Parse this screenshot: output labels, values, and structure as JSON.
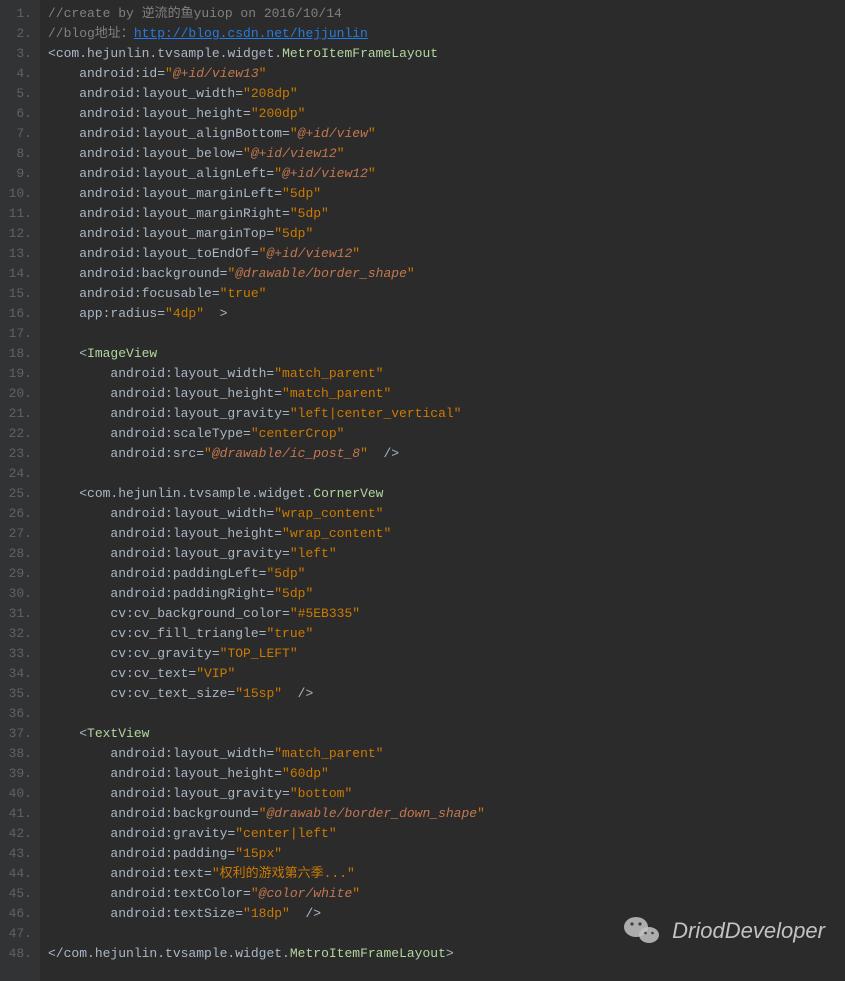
{
  "watermark": {
    "text": "DriodDeveloper"
  },
  "code_render": {
    "1": [
      {
        "cls": "c-comment",
        "t": "//create by 逆流的鱼yuiop on 2016/10/14"
      }
    ],
    "2": [
      {
        "cls": "c-comment",
        "t": "//blog地址："
      },
      {
        "cls": "c-url",
        "t": "http://blog.csdn.net/hejjunlin"
      }
    ],
    "3": [
      {
        "cls": "c-bracket",
        "t": "<"
      },
      {
        "cls": "c-default",
        "t": "com.hejunlin.tvsample.widget."
      },
      {
        "cls": "c-class",
        "t": "MetroItemFrameLayout"
      }
    ],
    "4": [
      {
        "cls": "c-default",
        "t": "    android:id="
      },
      {
        "cls": "c-str",
        "t": "\""
      },
      {
        "cls": "c-id",
        "t": "@+id/view13"
      },
      {
        "cls": "c-str",
        "t": "\""
      }
    ],
    "5": [
      {
        "cls": "c-default",
        "t": "    android:layout_width="
      },
      {
        "cls": "c-str",
        "t": "\"208dp\""
      }
    ],
    "6": [
      {
        "cls": "c-default",
        "t": "    android:layout_height="
      },
      {
        "cls": "c-str",
        "t": "\"200dp\""
      }
    ],
    "7": [
      {
        "cls": "c-default",
        "t": "    android:layout_alignBottom="
      },
      {
        "cls": "c-str",
        "t": "\""
      },
      {
        "cls": "c-id",
        "t": "@+id/view"
      },
      {
        "cls": "c-str",
        "t": "\""
      }
    ],
    "8": [
      {
        "cls": "c-default",
        "t": "    android:layout_below="
      },
      {
        "cls": "c-str",
        "t": "\""
      },
      {
        "cls": "c-id",
        "t": "@+id/view12"
      },
      {
        "cls": "c-str",
        "t": "\""
      }
    ],
    "9": [
      {
        "cls": "c-default",
        "t": "    android:layout_alignLeft="
      },
      {
        "cls": "c-str",
        "t": "\""
      },
      {
        "cls": "c-id",
        "t": "@+id/view12"
      },
      {
        "cls": "c-str",
        "t": "\""
      }
    ],
    "10": [
      {
        "cls": "c-default",
        "t": "    android:layout_marginLeft="
      },
      {
        "cls": "c-str",
        "t": "\"5dp\""
      }
    ],
    "11": [
      {
        "cls": "c-default",
        "t": "    android:layout_marginRight="
      },
      {
        "cls": "c-str",
        "t": "\"5dp\""
      }
    ],
    "12": [
      {
        "cls": "c-default",
        "t": "    android:layout_marginTop="
      },
      {
        "cls": "c-str",
        "t": "\"5dp\""
      }
    ],
    "13": [
      {
        "cls": "c-default",
        "t": "    android:layout_toEndOf="
      },
      {
        "cls": "c-str",
        "t": "\""
      },
      {
        "cls": "c-id",
        "t": "@+id/view12"
      },
      {
        "cls": "c-str",
        "t": "\""
      }
    ],
    "14": [
      {
        "cls": "c-default",
        "t": "    android:background="
      },
      {
        "cls": "c-str",
        "t": "\""
      },
      {
        "cls": "c-id",
        "t": "@drawable/border_shape"
      },
      {
        "cls": "c-str",
        "t": "\""
      }
    ],
    "15": [
      {
        "cls": "c-default",
        "t": "    android:focusable="
      },
      {
        "cls": "c-str",
        "t": "\"true\""
      }
    ],
    "16": [
      {
        "cls": "c-default",
        "t": "    app:radius="
      },
      {
        "cls": "c-str",
        "t": "\"4dp\""
      },
      {
        "cls": "c-bracket",
        "t": "  >"
      }
    ],
    "17": [
      {
        "cls": "c-default",
        "t": ""
      }
    ],
    "18": [
      {
        "cls": "c-bracket",
        "t": "    <"
      },
      {
        "cls": "c-tag",
        "t": "ImageView"
      }
    ],
    "19": [
      {
        "cls": "c-default",
        "t": "        android:layout_width="
      },
      {
        "cls": "c-str",
        "t": "\"match_parent\""
      }
    ],
    "20": [
      {
        "cls": "c-default",
        "t": "        android:layout_height="
      },
      {
        "cls": "c-str",
        "t": "\"match_parent\""
      }
    ],
    "21": [
      {
        "cls": "c-default",
        "t": "        android:layout_gravity="
      },
      {
        "cls": "c-str",
        "t": "\"left|center_vertical\""
      }
    ],
    "22": [
      {
        "cls": "c-default",
        "t": "        android:scaleType="
      },
      {
        "cls": "c-str",
        "t": "\"centerCrop\""
      }
    ],
    "23": [
      {
        "cls": "c-default",
        "t": "        android:src="
      },
      {
        "cls": "c-str",
        "t": "\""
      },
      {
        "cls": "c-id",
        "t": "@drawable/ic_post_8"
      },
      {
        "cls": "c-str",
        "t": "\""
      },
      {
        "cls": "c-bracket",
        "t": "  />"
      }
    ],
    "24": [
      {
        "cls": "c-default",
        "t": ""
      }
    ],
    "25": [
      {
        "cls": "c-bracket",
        "t": "    <"
      },
      {
        "cls": "c-default",
        "t": "com.hejunlin.tvsample.widget."
      },
      {
        "cls": "c-class",
        "t": "CornerVew"
      }
    ],
    "26": [
      {
        "cls": "c-default",
        "t": "        android:layout_width="
      },
      {
        "cls": "c-str",
        "t": "\"wrap_content\""
      }
    ],
    "27": [
      {
        "cls": "c-default",
        "t": "        android:layout_height="
      },
      {
        "cls": "c-str",
        "t": "\"wrap_content\""
      }
    ],
    "28": [
      {
        "cls": "c-default",
        "t": "        android:layout_gravity="
      },
      {
        "cls": "c-str",
        "t": "\"left\""
      }
    ],
    "29": [
      {
        "cls": "c-default",
        "t": "        android:paddingLeft="
      },
      {
        "cls": "c-str",
        "t": "\"5dp\""
      }
    ],
    "30": [
      {
        "cls": "c-default",
        "t": "        android:paddingRight="
      },
      {
        "cls": "c-str",
        "t": "\"5dp\""
      }
    ],
    "31": [
      {
        "cls": "c-default",
        "t": "        cv:cv_background_color="
      },
      {
        "cls": "c-str",
        "t": "\"#5EB335\""
      }
    ],
    "32": [
      {
        "cls": "c-default",
        "t": "        cv:cv_fill_triangle="
      },
      {
        "cls": "c-str",
        "t": "\"true\""
      }
    ],
    "33": [
      {
        "cls": "c-default",
        "t": "        cv:cv_gravity="
      },
      {
        "cls": "c-str",
        "t": "\"TOP_LEFT\""
      }
    ],
    "34": [
      {
        "cls": "c-default",
        "t": "        cv:cv_text="
      },
      {
        "cls": "c-str",
        "t": "\"VIP\""
      }
    ],
    "35": [
      {
        "cls": "c-default",
        "t": "        cv:cv_text_size="
      },
      {
        "cls": "c-str",
        "t": "\"15sp\""
      },
      {
        "cls": "c-bracket",
        "t": "  />"
      }
    ],
    "36": [
      {
        "cls": "c-default",
        "t": ""
      }
    ],
    "37": [
      {
        "cls": "c-bracket",
        "t": "    <"
      },
      {
        "cls": "c-tag",
        "t": "TextView"
      }
    ],
    "38": [
      {
        "cls": "c-default",
        "t": "        android:layout_width="
      },
      {
        "cls": "c-str",
        "t": "\"match_parent\""
      }
    ],
    "39": [
      {
        "cls": "c-default",
        "t": "        android:layout_height="
      },
      {
        "cls": "c-str",
        "t": "\"60dp\""
      }
    ],
    "40": [
      {
        "cls": "c-default",
        "t": "        android:layout_gravity="
      },
      {
        "cls": "c-str",
        "t": "\"bottom\""
      }
    ],
    "41": [
      {
        "cls": "c-default",
        "t": "        android:background="
      },
      {
        "cls": "c-str",
        "t": "\""
      },
      {
        "cls": "c-id",
        "t": "@drawable/border_down_shape"
      },
      {
        "cls": "c-str",
        "t": "\""
      }
    ],
    "42": [
      {
        "cls": "c-default",
        "t": "        android:gravity="
      },
      {
        "cls": "c-str",
        "t": "\"center|left\""
      }
    ],
    "43": [
      {
        "cls": "c-default",
        "t": "        android:padding="
      },
      {
        "cls": "c-str",
        "t": "\"15px\""
      }
    ],
    "44": [
      {
        "cls": "c-default",
        "t": "        android:text="
      },
      {
        "cls": "c-str",
        "t": "\"权利的游戏第六季...\""
      }
    ],
    "45": [
      {
        "cls": "c-default",
        "t": "        android:textColor="
      },
      {
        "cls": "c-str",
        "t": "\""
      },
      {
        "cls": "c-id",
        "t": "@color/white"
      },
      {
        "cls": "c-str",
        "t": "\""
      }
    ],
    "46": [
      {
        "cls": "c-default",
        "t": "        android:textSize="
      },
      {
        "cls": "c-str",
        "t": "\"18dp\""
      },
      {
        "cls": "c-bracket",
        "t": "  />"
      }
    ],
    "47": [
      {
        "cls": "c-default",
        "t": ""
      }
    ],
    "48": [
      {
        "cls": "c-bracket",
        "t": "</"
      },
      {
        "cls": "c-default",
        "t": "com.hejunlin.tvsample.widget."
      },
      {
        "cls": "c-class",
        "t": "MetroItemFrameLayout"
      },
      {
        "cls": "c-bracket",
        "t": ">"
      }
    ]
  }
}
